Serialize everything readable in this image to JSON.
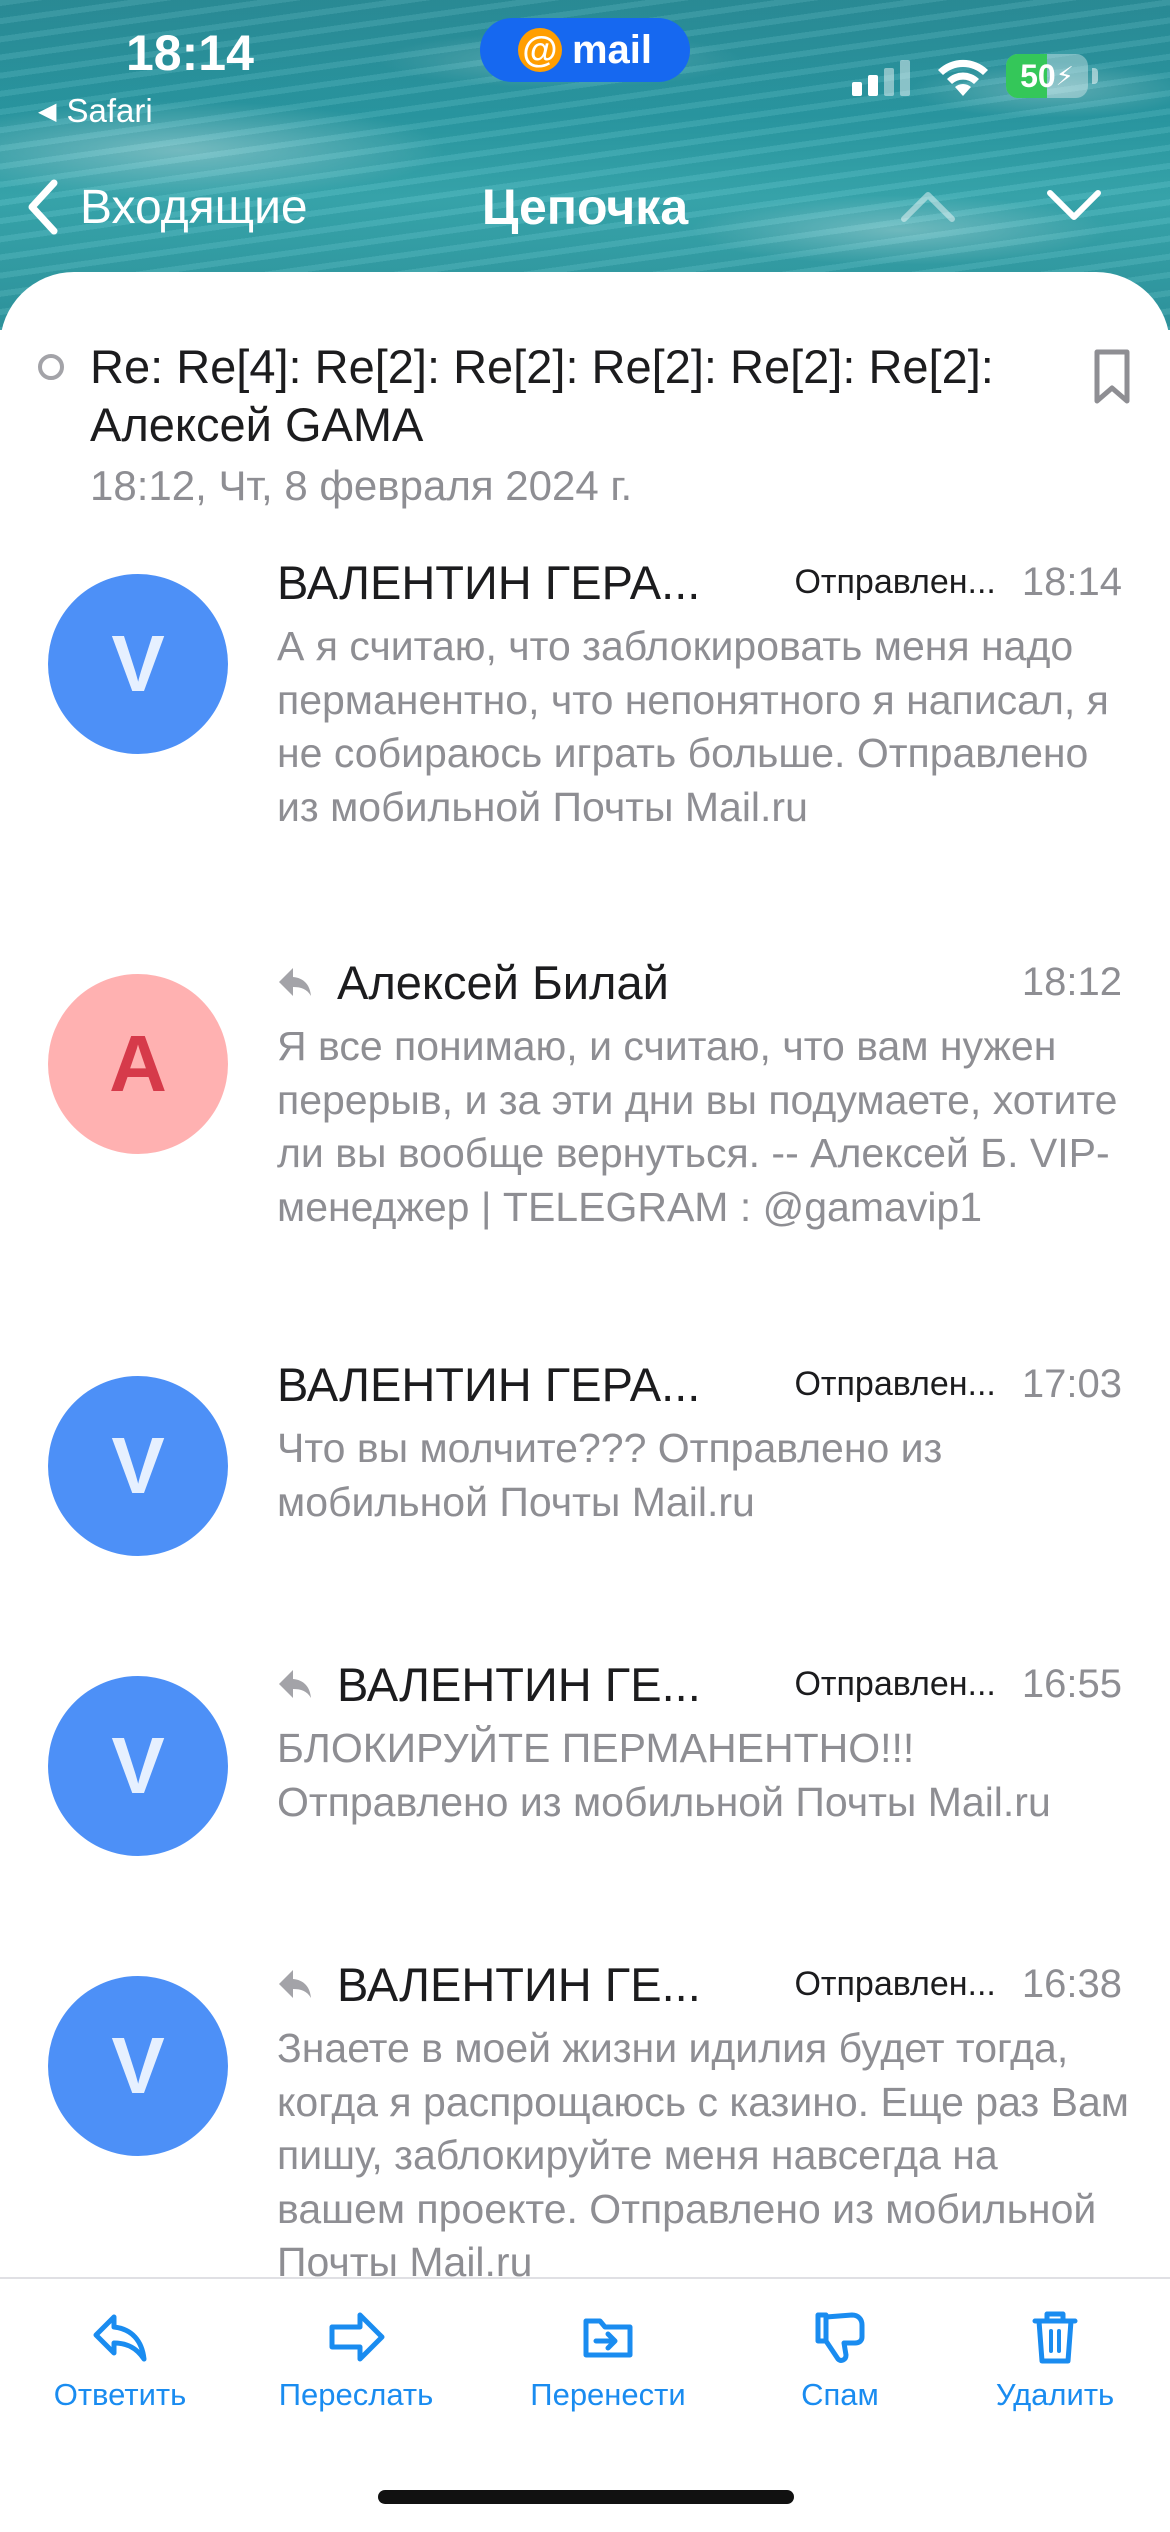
{
  "status_bar": {
    "time": "18:14",
    "back_app": "Safari",
    "brand": "mail",
    "battery": "50",
    "battery_level_percent": 50
  },
  "nav": {
    "back_label": "Входящие",
    "title": "Цепочка"
  },
  "thread": {
    "subject": "Re: Re[4]: Re[2]: Re[2]: Re[2]: Re[2]: Re[2]: Алексей GAMA",
    "date": "18:12, Чт, 8 февраля 2024 г."
  },
  "messages": [
    {
      "avatar": "V",
      "avatar_color": "#4d90f7",
      "replied": false,
      "sender": "ВАЛЕНТИН ГЕРА...",
      "folder": "Отправлен...",
      "time": "18:14",
      "snippet": "А я считаю, что заблокировать меня надо перманентно, что непонятного я написал, я не собираюсь играть больше. Отправлено из мобильной Почты Mail.ru"
    },
    {
      "avatar": "А",
      "avatar_color": "#ffb1b1",
      "replied": true,
      "sender": "Алексей Билай",
      "folder": "",
      "time": "18:12",
      "snippet": "Я все понимаю, и считаю, что вам нужен перерыв, и за эти дни вы подумаете, хотите ли вы вообще вернуться. -- Алексей Б. VIP-менеджер | TELEGRAM : @gamavip1"
    },
    {
      "avatar": "V",
      "avatar_color": "#4d90f7",
      "replied": false,
      "sender": "ВАЛЕНТИН ГЕРА...",
      "folder": "Отправлен...",
      "time": "17:03",
      "snippet": "Что вы молчите??? Отправлено из мобильной Почты Mail.ru"
    },
    {
      "avatar": "V",
      "avatar_color": "#4d90f7",
      "replied": true,
      "sender": "ВАЛЕНТИН ГЕ...",
      "folder": "Отправлен...",
      "time": "16:55",
      "snippet": "БЛОКИРУЙТЕ ПЕРМАНЕНТНО!!! Отправлено из мобильной Почты Mail.ru"
    },
    {
      "avatar": "V",
      "avatar_color": "#4d90f7",
      "replied": true,
      "sender": "ВАЛЕНТИН ГЕ...",
      "folder": "Отправлен...",
      "time": "16:38",
      "snippet": "Знаете в моей жизни идилия будет тогда, когда я распрощаюсь с казино. Еще раз Вам пишу, заблокируйте меня навсегда на вашем проекте. Отправлено из мобильной Почты Mail.ru"
    }
  ],
  "toolbar": {
    "reply": "Ответить",
    "forward": "Переслать",
    "move": "Перенести",
    "spam": "Спам",
    "delete": "Удалить"
  },
  "colors": {
    "accent": "#1a8cf0",
    "brand_pill": "#1668f0",
    "battery": "#34c759"
  }
}
